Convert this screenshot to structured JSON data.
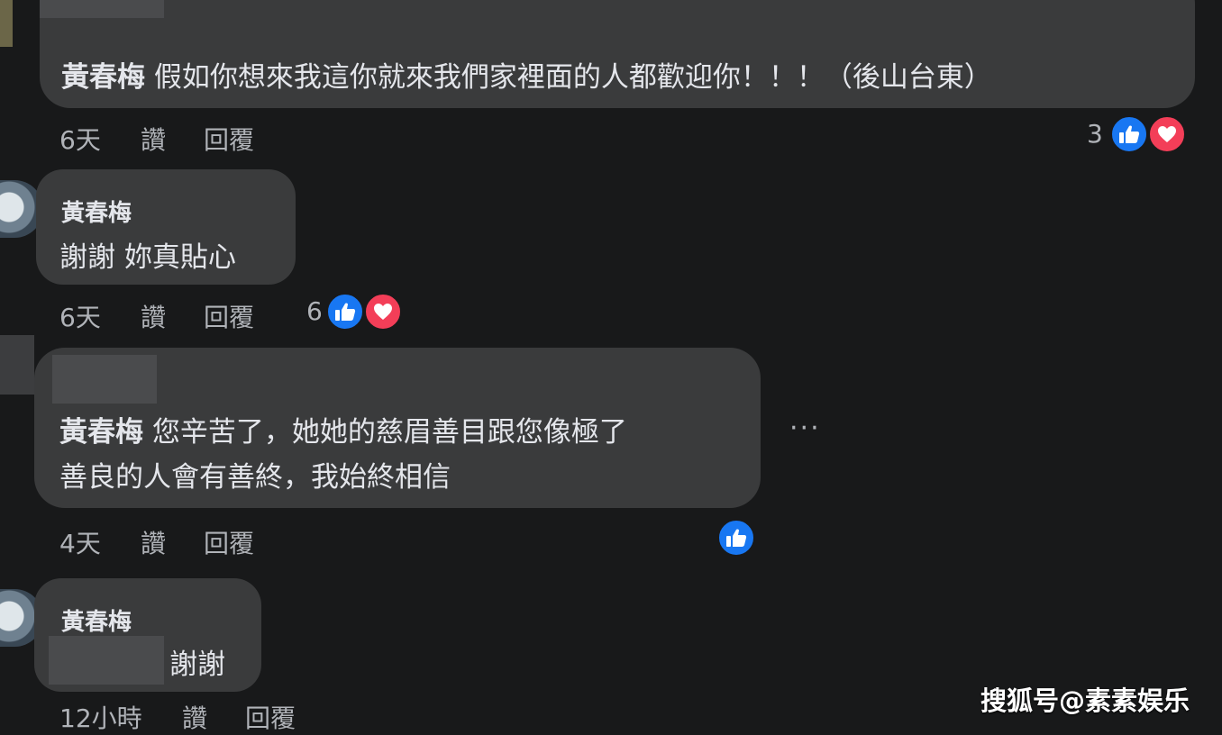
{
  "comments": [
    {
      "author": "黃春梅",
      "text": "假如你想來我這你就來我們家裡面的人都歡迎你！！！（後山台東）",
      "time": "6天",
      "like_label": "讚",
      "reply_label": "回覆",
      "reaction_count": "3"
    },
    {
      "author": "黃春梅",
      "text": "謝謝 妳真貼心",
      "time": "6天",
      "like_label": "讚",
      "reply_label": "回覆",
      "reaction_count": "6"
    },
    {
      "author": "黃春梅",
      "text_line1": "您辛苦了，她她的慈眉善目跟您像極了",
      "text_line2": "善良的人會有善終，我始終相信",
      "time": "4天",
      "like_label": "讚",
      "reply_label": "回覆",
      "more": "···"
    },
    {
      "author": "黃春梅",
      "text": "謝謝",
      "time": "12小時",
      "like_label": "讚",
      "reply_label": "回覆"
    }
  ],
  "icons": {
    "like": "thumbs-up-icon",
    "love": "heart-icon",
    "more": "more-options-icon"
  },
  "colors": {
    "background": "#18191a",
    "bubble": "#3a3b3c",
    "like_blue": "#1877f2",
    "love_red": "#f33e58",
    "meta_gray": "#b0b3b8"
  },
  "watermark": "搜狐号@素素娱乐"
}
